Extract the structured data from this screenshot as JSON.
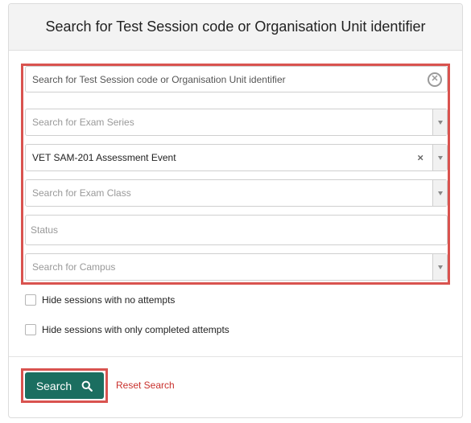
{
  "panel": {
    "title": "Search for Test Session code or Organisation Unit identifier"
  },
  "fields": {
    "session_search": {
      "placeholder": "Search for Test Session code or Organisation Unit identifier",
      "value": ""
    },
    "exam_series": {
      "placeholder": "Search for Exam Series"
    },
    "assessment_event": {
      "value": "VET SAM-201 Assessment Event",
      "clear_symbol": "×"
    },
    "exam_class": {
      "placeholder": "Search for Exam Class"
    },
    "status": {
      "placeholder": "Status"
    },
    "campus": {
      "placeholder": "Search for Campus"
    }
  },
  "options": {
    "hide_no_attempts": {
      "label": "Hide sessions with no attempts",
      "checked": false
    },
    "hide_completed": {
      "label": "Hide sessions with only completed attempts",
      "checked": false
    }
  },
  "actions": {
    "search_label": "Search",
    "reset_label": "Reset Search"
  },
  "colors": {
    "highlight": "#d9534f",
    "search_button": "#1b6e60",
    "reset_link": "#c9302c"
  },
  "icons": {
    "search": "magnifier-icon",
    "clear": "clear-circle-icon",
    "dropdown": "caret-down-icon"
  }
}
